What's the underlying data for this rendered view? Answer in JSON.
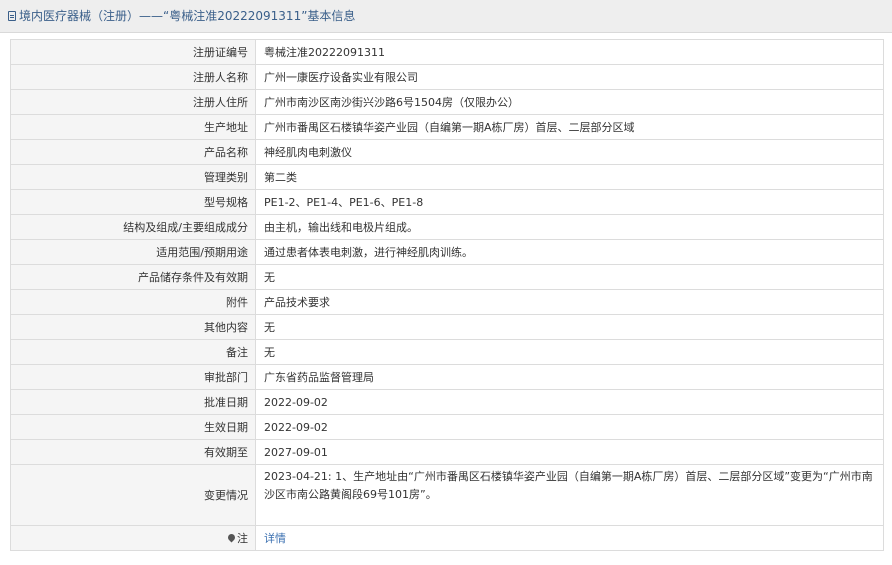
{
  "header": {
    "title": "境内医疗器械（注册）——“粤械注准20222091311”基本信息"
  },
  "rows": [
    {
      "label": "注册证编号",
      "value": "粤械注准20222091311"
    },
    {
      "label": "注册人名称",
      "value": "广州一康医疗设备实业有限公司"
    },
    {
      "label": "注册人住所",
      "value": "广州市南沙区南沙街兴沙路6号1504房（仅限办公）"
    },
    {
      "label": "生产地址",
      "value": "广州市番禺区石楼镇华姿产业园（自编第一期A栋厂房）首层、二层部分区域"
    },
    {
      "label": "产品名称",
      "value": "神经肌肉电刺激仪"
    },
    {
      "label": "管理类别",
      "value": "第二类"
    },
    {
      "label": "型号规格",
      "value": "PE1-2、PE1-4、PE1-6、PE1-8"
    },
    {
      "label": "结构及组成/主要组成成分",
      "value": "由主机，输出线和电极片组成。"
    },
    {
      "label": "适用范围/预期用途",
      "value": "通过患者体表电刺激，进行神经肌肉训练。"
    },
    {
      "label": "产品储存条件及有效期",
      "value": "无"
    },
    {
      "label": "附件",
      "value": "产品技术要求"
    },
    {
      "label": "其他内容",
      "value": "无"
    },
    {
      "label": "备注",
      "value": "无"
    },
    {
      "label": "审批部门",
      "value": "广东省药品监督管理局"
    },
    {
      "label": "批准日期",
      "value": "2022-09-02"
    },
    {
      "label": "生效日期",
      "value": "2022-09-02"
    },
    {
      "label": "有效期至",
      "value": "2027-09-01"
    },
    {
      "label": "变更情况",
      "value": "2023-04-21: 1、生产地址由“广州市番禺区石楼镇华姿产业园（自编第一期A栋厂房）首层、二层部分区域”变更为“广州市南沙区市南公路黄阁段69号101房”。"
    }
  ],
  "note": {
    "label": "注",
    "link_text": "详情"
  }
}
